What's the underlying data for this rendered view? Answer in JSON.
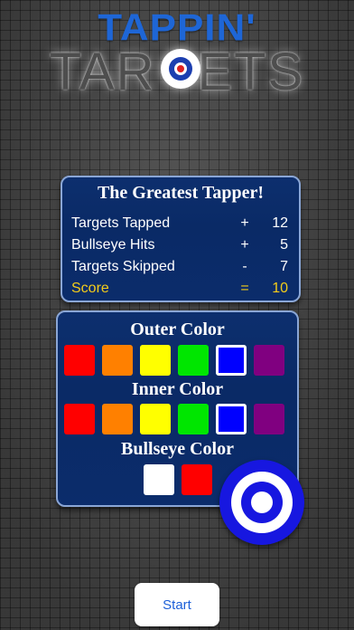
{
  "logo": {
    "line1": "TAPPIN'",
    "line2": "TARGETS",
    "line2_left": "TAR",
    "line2_right": "ETS"
  },
  "stats": {
    "title": "The Greatest Tapper!",
    "rows": [
      {
        "label": "Targets Tapped",
        "op": "+",
        "value": "12"
      },
      {
        "label": "Bullseye Hits",
        "op": "+",
        "value": "5"
      },
      {
        "label": "Targets Skipped",
        "op": "-",
        "value": "7"
      },
      {
        "label": "Score",
        "op": "=",
        "value": "10"
      }
    ]
  },
  "color_picker": {
    "outer_title": "Outer Color",
    "inner_title": "Inner Color",
    "bullseye_title": "Bullseye Color",
    "outer_swatches": [
      {
        "color": "#ff0000",
        "selected": false
      },
      {
        "color": "#ff8000",
        "selected": false
      },
      {
        "color": "#ffff00",
        "selected": false
      },
      {
        "color": "#00e600",
        "selected": false
      },
      {
        "color": "#0000ff",
        "selected": true
      },
      {
        "color": "#800080",
        "selected": false
      }
    ],
    "inner_swatches": [
      {
        "color": "#ff0000",
        "selected": false
      },
      {
        "color": "#ff8000",
        "selected": false
      },
      {
        "color": "#ffff00",
        "selected": false
      },
      {
        "color": "#00e600",
        "selected": false
      },
      {
        "color": "#0000ff",
        "selected": true
      },
      {
        "color": "#800080",
        "selected": false
      }
    ],
    "bullseye_swatches": [
      {
        "color": "#ffffff",
        "selected": false
      },
      {
        "color": "#ff0000",
        "selected": false
      }
    ],
    "preview": {
      "outer": "#1717e0",
      "inner": "#1717e0",
      "bullseye": "#ffffff"
    }
  },
  "start_button": {
    "label": "Start"
  },
  "colors": {
    "panel": "#0b2c6b",
    "accent_score": "#f3cc1a",
    "button_text": "#1c5fd8"
  }
}
